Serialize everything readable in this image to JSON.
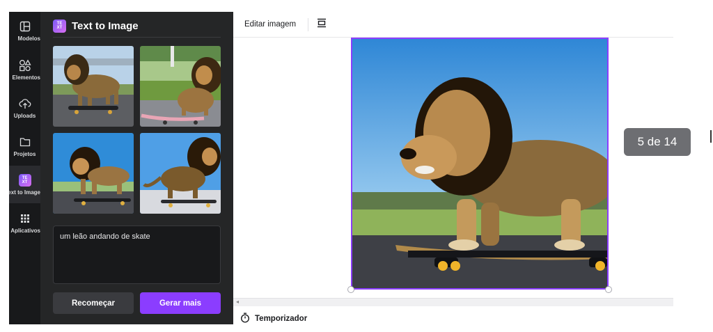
{
  "sidebar": {
    "items": [
      {
        "label": "Modelos",
        "icon": "layout-icon"
      },
      {
        "label": "Elementos",
        "icon": "shapes-icon"
      },
      {
        "label": "Uploads",
        "icon": "cloud-upload-icon"
      },
      {
        "label": "Projetos",
        "icon": "folder-icon"
      },
      {
        "label": "Text to Image",
        "icon": "text-to-image-app-icon",
        "active": true
      },
      {
        "label": "Aplicativos",
        "icon": "apps-grid-icon"
      }
    ]
  },
  "panel": {
    "title": "Text to Image",
    "badge_text": "TE XT",
    "prompt": "um leão andando de skate",
    "restart_label": "Recomeçar",
    "generate_label": "Gerar mais"
  },
  "toolbar": {
    "edit_label": "Editar imagem"
  },
  "canvas": {
    "page_indicator": "5 de 14",
    "accent": "#8b3dff"
  },
  "footer": {
    "timer_label": "Temporizador"
  }
}
